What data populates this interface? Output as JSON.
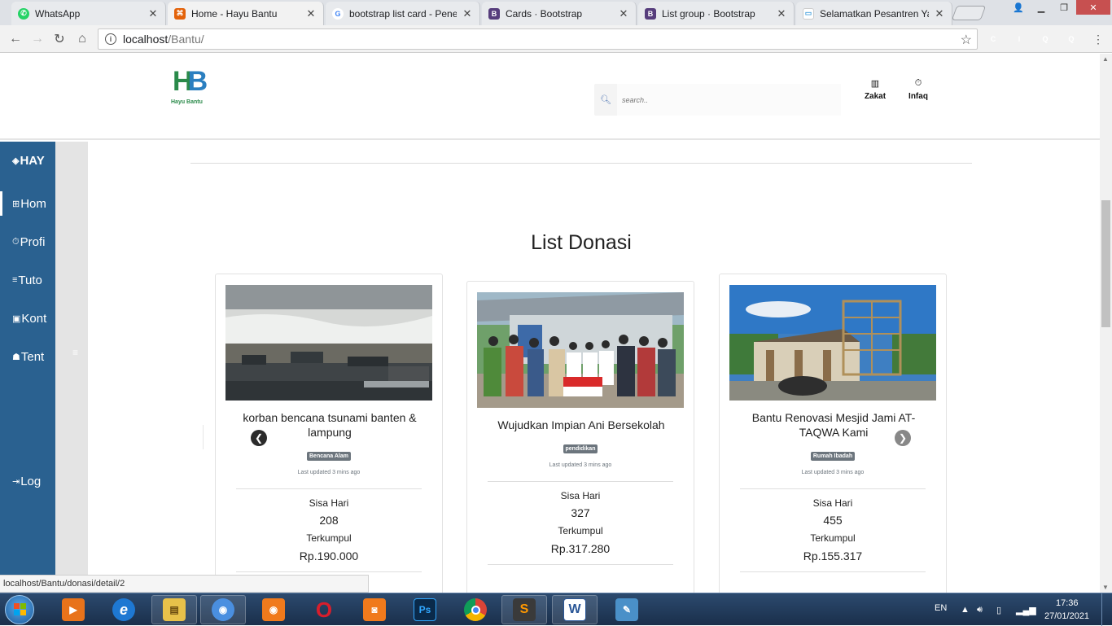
{
  "browser": {
    "tabs": [
      {
        "title": "WhatsApp",
        "icon": "whatsapp-icon",
        "color": "#25d366",
        "glyph": "✆"
      },
      {
        "title": "Home - Hayu Bantu",
        "icon": "site-icon",
        "color": "#e36209",
        "glyph": "⌘"
      },
      {
        "title": "bootstrap list card - Pene",
        "icon": "google-icon",
        "color": "#4285f4",
        "glyph": "G"
      },
      {
        "title": "Cards · Bootstrap",
        "icon": "bootstrap-icon",
        "color": "#563d7c",
        "glyph": "B"
      },
      {
        "title": "List group · Bootstrap",
        "icon": "bootstrap-icon",
        "color": "#563d7c",
        "glyph": "B"
      },
      {
        "title": "Selamatkan Pesantren Ya",
        "icon": "page-icon",
        "color": "#4aa3df",
        "glyph": "▭"
      }
    ],
    "close_glyph": "✕",
    "url_host": "localhost",
    "url_path": "/Bantu/",
    "status_url": "localhost/Bantu/donasi/detail/2",
    "extensions": [
      {
        "name": "ext-c-icon",
        "glyph": "C",
        "color": "#9e9e9e"
      },
      {
        "name": "ext-i-icon",
        "glyph": "I",
        "color": "#9e9e9e"
      },
      {
        "name": "ext-q-icon",
        "glyph": "Q",
        "color": "#1a73e8"
      },
      {
        "name": "ext-q2-icon",
        "glyph": "Q",
        "color": "#1a73e8"
      }
    ]
  },
  "site": {
    "logo_text": "Hayu Bantu",
    "logo_mark_a": "H",
    "logo_mark_b": "B",
    "search_placeholder": "search..",
    "header_links": [
      {
        "label": "Zakat",
        "icon": "chart-icon",
        "glyph": "📊"
      },
      {
        "label": "Infaq",
        "icon": "stopwatch-icon",
        "glyph": "⏱"
      }
    ],
    "sidebar": {
      "brand": "HAY",
      "brand_glyph": "◈",
      "items": [
        {
          "label": "Hom",
          "glyph": "⊞",
          "icon": "grid-icon"
        },
        {
          "label": "Profi",
          "glyph": "⏱",
          "icon": "power-icon"
        },
        {
          "label": "Tuto",
          "glyph": "≡",
          "icon": "list-icon"
        },
        {
          "label": "Kont",
          "glyph": "▣",
          "icon": "contact-icon"
        },
        {
          "label": "Tent",
          "glyph": "☗",
          "icon": "info-icon"
        }
      ],
      "logout": {
        "label": "Log",
        "glyph": "⇥"
      },
      "toggle_glyph": "≡"
    },
    "section_title": "List Donasi",
    "cards": [
      {
        "title": "korban bencana tsunami banten & lampung",
        "badge": "Bencana Alam",
        "updated": "Last updated 3 mins ago",
        "sisa_label": "Sisa Hari",
        "sisa_value": "208",
        "terkumpul_label": "Terkumpul",
        "terkumpul_value": "Rp.190.000"
      },
      {
        "title": "Wujudkan Impian Ani Bersekolah",
        "badge": "pendidikan",
        "updated": "Last updated 3 mins ago",
        "sisa_label": "Sisa Hari",
        "sisa_value": "327",
        "terkumpul_label": "Terkumpul",
        "terkumpul_value": "Rp.317.280"
      },
      {
        "title": "Bantu Renovasi Mesjid Jami AT-TAQWA Kami",
        "badge": "Rumah Ibadah",
        "updated": "Last updated 3 mins ago",
        "sisa_label": "Sisa Hari",
        "sisa_value": "455",
        "terkumpul_label": "Terkumpul",
        "terkumpul_value": "Rp.155.317"
      }
    ],
    "carousel": {
      "prev_glyph": "❮",
      "next_glyph": "❯"
    }
  },
  "taskbar": {
    "language": "EN",
    "time": "17:36",
    "date": "27/01/2021",
    "apps": [
      {
        "name": "media-player-icon",
        "glyph": "▶",
        "color": "#e8731b",
        "open": false
      },
      {
        "name": "internet-explorer-icon",
        "glyph": "e",
        "color": "#1e78d2",
        "open": false
      },
      {
        "name": "file-explorer-icon",
        "glyph": "▤",
        "color": "#e8c14a",
        "open": true
      },
      {
        "name": "chrome-taskbar-icon",
        "glyph": "◉",
        "color": "#4a8fe0",
        "open": true
      },
      {
        "name": "screen-recorder-icon",
        "glyph": "◉",
        "color": "#f07a1c",
        "open": false
      },
      {
        "name": "opera-icon",
        "glyph": "O",
        "color": "#d81e2c",
        "open": false
      },
      {
        "name": "camera-app-icon",
        "glyph": "◙",
        "color": "#f07a1c",
        "open": false
      },
      {
        "name": "photoshop-icon",
        "glyph": "Ps",
        "color": "#0a2a4a",
        "open": false
      },
      {
        "name": "chrome-icon",
        "glyph": "◎",
        "color": "#2e9e44",
        "open": false
      },
      {
        "name": "sublime-icon",
        "glyph": "S",
        "color": "#3a3a3a",
        "open": true
      },
      {
        "name": "word-icon",
        "glyph": "W",
        "color": "#2b5797",
        "open": true
      },
      {
        "name": "paint-icon",
        "glyph": "✎",
        "color": "#4a90c8",
        "open": false
      }
    ]
  }
}
